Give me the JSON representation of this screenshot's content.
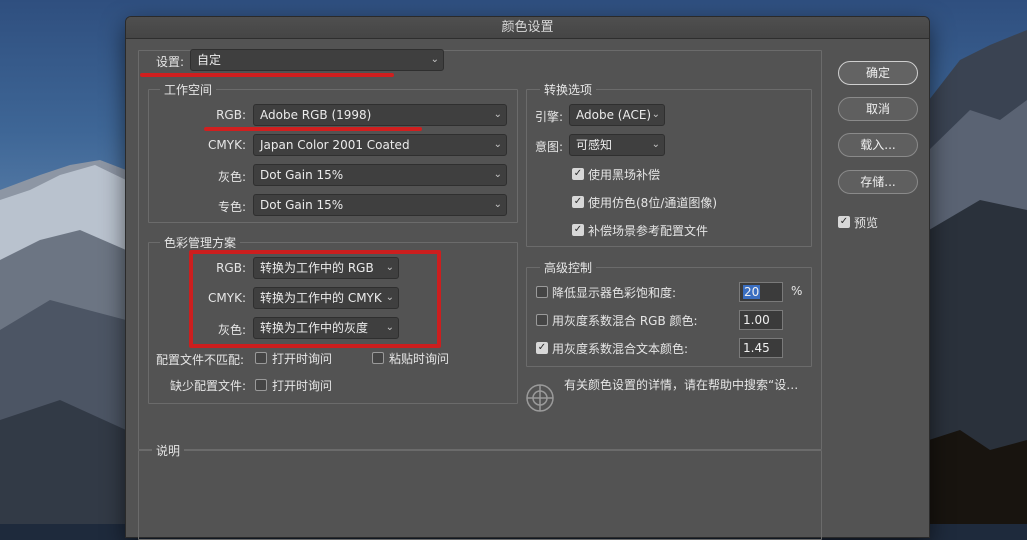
{
  "dialog": {
    "title": "颜色设置"
  },
  "settings": {
    "label": "设置:",
    "value": "自定"
  },
  "working_spaces": {
    "title": "工作空间",
    "rows": [
      {
        "label": "RGB:",
        "value": "Adobe RGB (1998)"
      },
      {
        "label": "CMYK:",
        "value": "Japan Color 2001 Coated"
      },
      {
        "label": "灰色:",
        "value": "Dot Gain 15%"
      },
      {
        "label": "专色:",
        "value": "Dot Gain 15%"
      }
    ]
  },
  "policies": {
    "title": "色彩管理方案",
    "rows": [
      {
        "label": "RGB:",
        "value": "转换为工作中的 RGB"
      },
      {
        "label": "CMYK:",
        "value": "转换为工作中的 CMYK"
      },
      {
        "label": "灰色:",
        "value": "转换为工作中的灰度"
      }
    ],
    "mismatch_label": "配置文件不匹配:",
    "missing_label": "缺少配置文件:",
    "ask_open": "打开时询问",
    "ask_paste": "粘贴时询问",
    "ask_open_missing": "打开时询问"
  },
  "conversion": {
    "title": "转换选项",
    "engine_label": "引擎:",
    "engine_value": "Adobe (ACE)",
    "intent_label": "意图:",
    "intent_value": "可感知",
    "black_point": "使用黑场补偿",
    "dither": "使用仿色(8位/通道图像)",
    "compensate": "补偿场景参考配置文件"
  },
  "advanced": {
    "title": "高级控制",
    "desaturate_label": "降低显示器色彩饱和度:",
    "desaturate_value": "20",
    "desaturate_unit": "%",
    "blend_rgb_label": "用灰度系数混合 RGB 颜色:",
    "blend_rgb_value": "1.00",
    "blend_text_label": "用灰度系数混合文本颜色:",
    "blend_text_value": "1.45"
  },
  "info_text": "有关颜色设置的详情，请在帮助中搜索“设…",
  "description": {
    "title": "说明"
  },
  "buttons": {
    "ok": "确定",
    "cancel": "取消",
    "load": "载入...",
    "save": "存储..."
  },
  "preview_label": "预览",
  "icon_names": [
    "chevron-down-icon",
    "checkmark-icon",
    "color-wheel-icon"
  ],
  "colors": {
    "annotation_red": "#cc1e1e",
    "selection_blue": "#3a6ec0",
    "dialog_bg": "#535353"
  }
}
